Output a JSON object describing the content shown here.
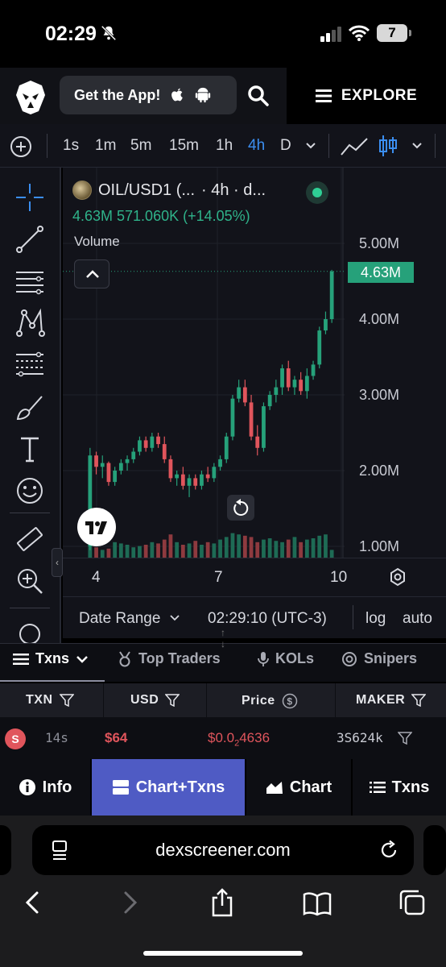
{
  "status": {
    "time": "02:29",
    "battery": "7"
  },
  "header": {
    "get_app": "Get the App!",
    "explore": "EXPLORE"
  },
  "timeframes": [
    "1s",
    "1m",
    "5m",
    "15m",
    "1h",
    "4h",
    "D"
  ],
  "active_timeframe": "4h",
  "chart": {
    "pair": "OIL/USD1 (...",
    "interval": "· 4h · d...",
    "legend_values": "4.63M  571.060K (+14.05%)",
    "indicator": "Volume",
    "last_price_tag": "4.63M",
    "y_ticks": [
      "5.00M",
      "4.00M",
      "3.00M",
      "2.00M",
      "1.00M"
    ],
    "x_ticks": [
      "4",
      "7",
      "10"
    ]
  },
  "chart_data": {
    "type": "candlestick",
    "ylim": [
      0.9,
      5.4
    ],
    "ytick_values": [
      5.0,
      4.0,
      3.0,
      2.0,
      1.0
    ],
    "candles": [
      [
        1.0,
        2.3,
        0.95,
        2.2
      ],
      [
        2.2,
        2.25,
        1.95,
        2.05
      ],
      [
        2.05,
        2.2,
        1.9,
        2.1
      ],
      [
        2.1,
        2.12,
        1.8,
        1.85
      ],
      [
        1.85,
        2.05,
        1.8,
        2.0
      ],
      [
        2.0,
        2.15,
        1.95,
        2.1
      ],
      [
        2.1,
        2.2,
        2.0,
        2.15
      ],
      [
        2.15,
        2.3,
        2.1,
        2.25
      ],
      [
        2.25,
        2.45,
        2.2,
        2.4
      ],
      [
        2.4,
        2.45,
        2.25,
        2.3
      ],
      [
        2.3,
        2.5,
        2.25,
        2.45
      ],
      [
        2.45,
        2.5,
        2.3,
        2.35
      ],
      [
        2.35,
        2.45,
        2.1,
        2.15
      ],
      [
        2.15,
        2.2,
        1.85,
        1.9
      ],
      [
        1.9,
        2.0,
        1.8,
        1.95
      ],
      [
        1.95,
        2.05,
        1.75,
        1.8
      ],
      [
        1.8,
        1.95,
        1.65,
        1.9
      ],
      [
        1.9,
        1.95,
        1.75,
        1.8
      ],
      [
        1.8,
        2.0,
        1.75,
        1.95
      ],
      [
        1.95,
        2.05,
        1.85,
        1.9
      ],
      [
        1.9,
        2.1,
        1.85,
        2.05
      ],
      [
        2.05,
        2.2,
        2.0,
        2.15
      ],
      [
        2.15,
        2.5,
        2.1,
        2.45
      ],
      [
        2.45,
        3.0,
        2.4,
        2.95
      ],
      [
        2.95,
        3.2,
        2.9,
        3.1
      ],
      [
        3.1,
        3.2,
        2.85,
        2.9
      ],
      [
        2.9,
        3.0,
        2.4,
        2.45
      ],
      [
        2.45,
        2.6,
        2.2,
        2.3
      ],
      [
        2.3,
        2.9,
        2.25,
        2.85
      ],
      [
        2.85,
        3.05,
        2.8,
        3.0
      ],
      [
        3.0,
        3.2,
        2.9,
        3.1
      ],
      [
        3.1,
        3.4,
        3.0,
        3.35
      ],
      [
        3.35,
        3.45,
        3.05,
        3.1
      ],
      [
        3.1,
        3.25,
        3.0,
        3.2
      ],
      [
        3.2,
        3.3,
        3.0,
        3.05
      ],
      [
        3.05,
        3.35,
        2.95,
        3.25
      ],
      [
        3.25,
        3.45,
        3.2,
        3.4
      ],
      [
        3.4,
        3.9,
        3.35,
        3.85
      ],
      [
        3.85,
        4.1,
        3.8,
        4.0
      ],
      [
        4.0,
        4.65,
        3.95,
        4.63
      ]
    ],
    "volume": [
      0.5,
      0.4,
      0.3,
      0.35,
      0.6,
      0.55,
      0.5,
      0.4,
      0.45,
      0.5,
      0.6,
      0.55,
      0.7,
      0.9,
      0.6,
      0.5,
      0.55,
      0.65,
      0.5,
      0.6,
      0.55,
      0.7,
      0.8,
      0.95,
      0.9,
      0.85,
      0.8,
      0.6,
      0.7,
      0.75,
      0.65,
      0.6,
      0.7,
      0.8,
      0.6,
      0.7,
      0.75,
      0.85,
      0.9,
      0.3
    ]
  },
  "toolbar_bottom": {
    "date_range": "Date Range",
    "clock": "02:29:10 (UTC-3)",
    "log": "log",
    "auto": "auto"
  },
  "tabs": [
    {
      "label": "Txns",
      "active": true
    },
    {
      "label": "Top Traders",
      "active": false
    },
    {
      "label": "KOLs",
      "active": false
    },
    {
      "label": "Snipers",
      "active": false
    }
  ],
  "table": {
    "headers": [
      "TXN",
      "USD",
      "Price",
      "MAKER"
    ],
    "row": {
      "type": "S",
      "age": "14s",
      "usd": "$64",
      "price_prefix": "$0.0",
      "price_sub": "2",
      "price_rest": "4636",
      "maker": "3S624k"
    }
  },
  "bottom_nav": [
    "Info",
    "Chart+Txns",
    "Chart",
    "Txns"
  ],
  "active_nav": "Chart+Txns",
  "safari": {
    "url": "dexscreener.com"
  },
  "colors": {
    "up": "#26a17a",
    "down": "#e0555c",
    "accent": "#4f5bc4",
    "price_green": "#2fb38a"
  }
}
